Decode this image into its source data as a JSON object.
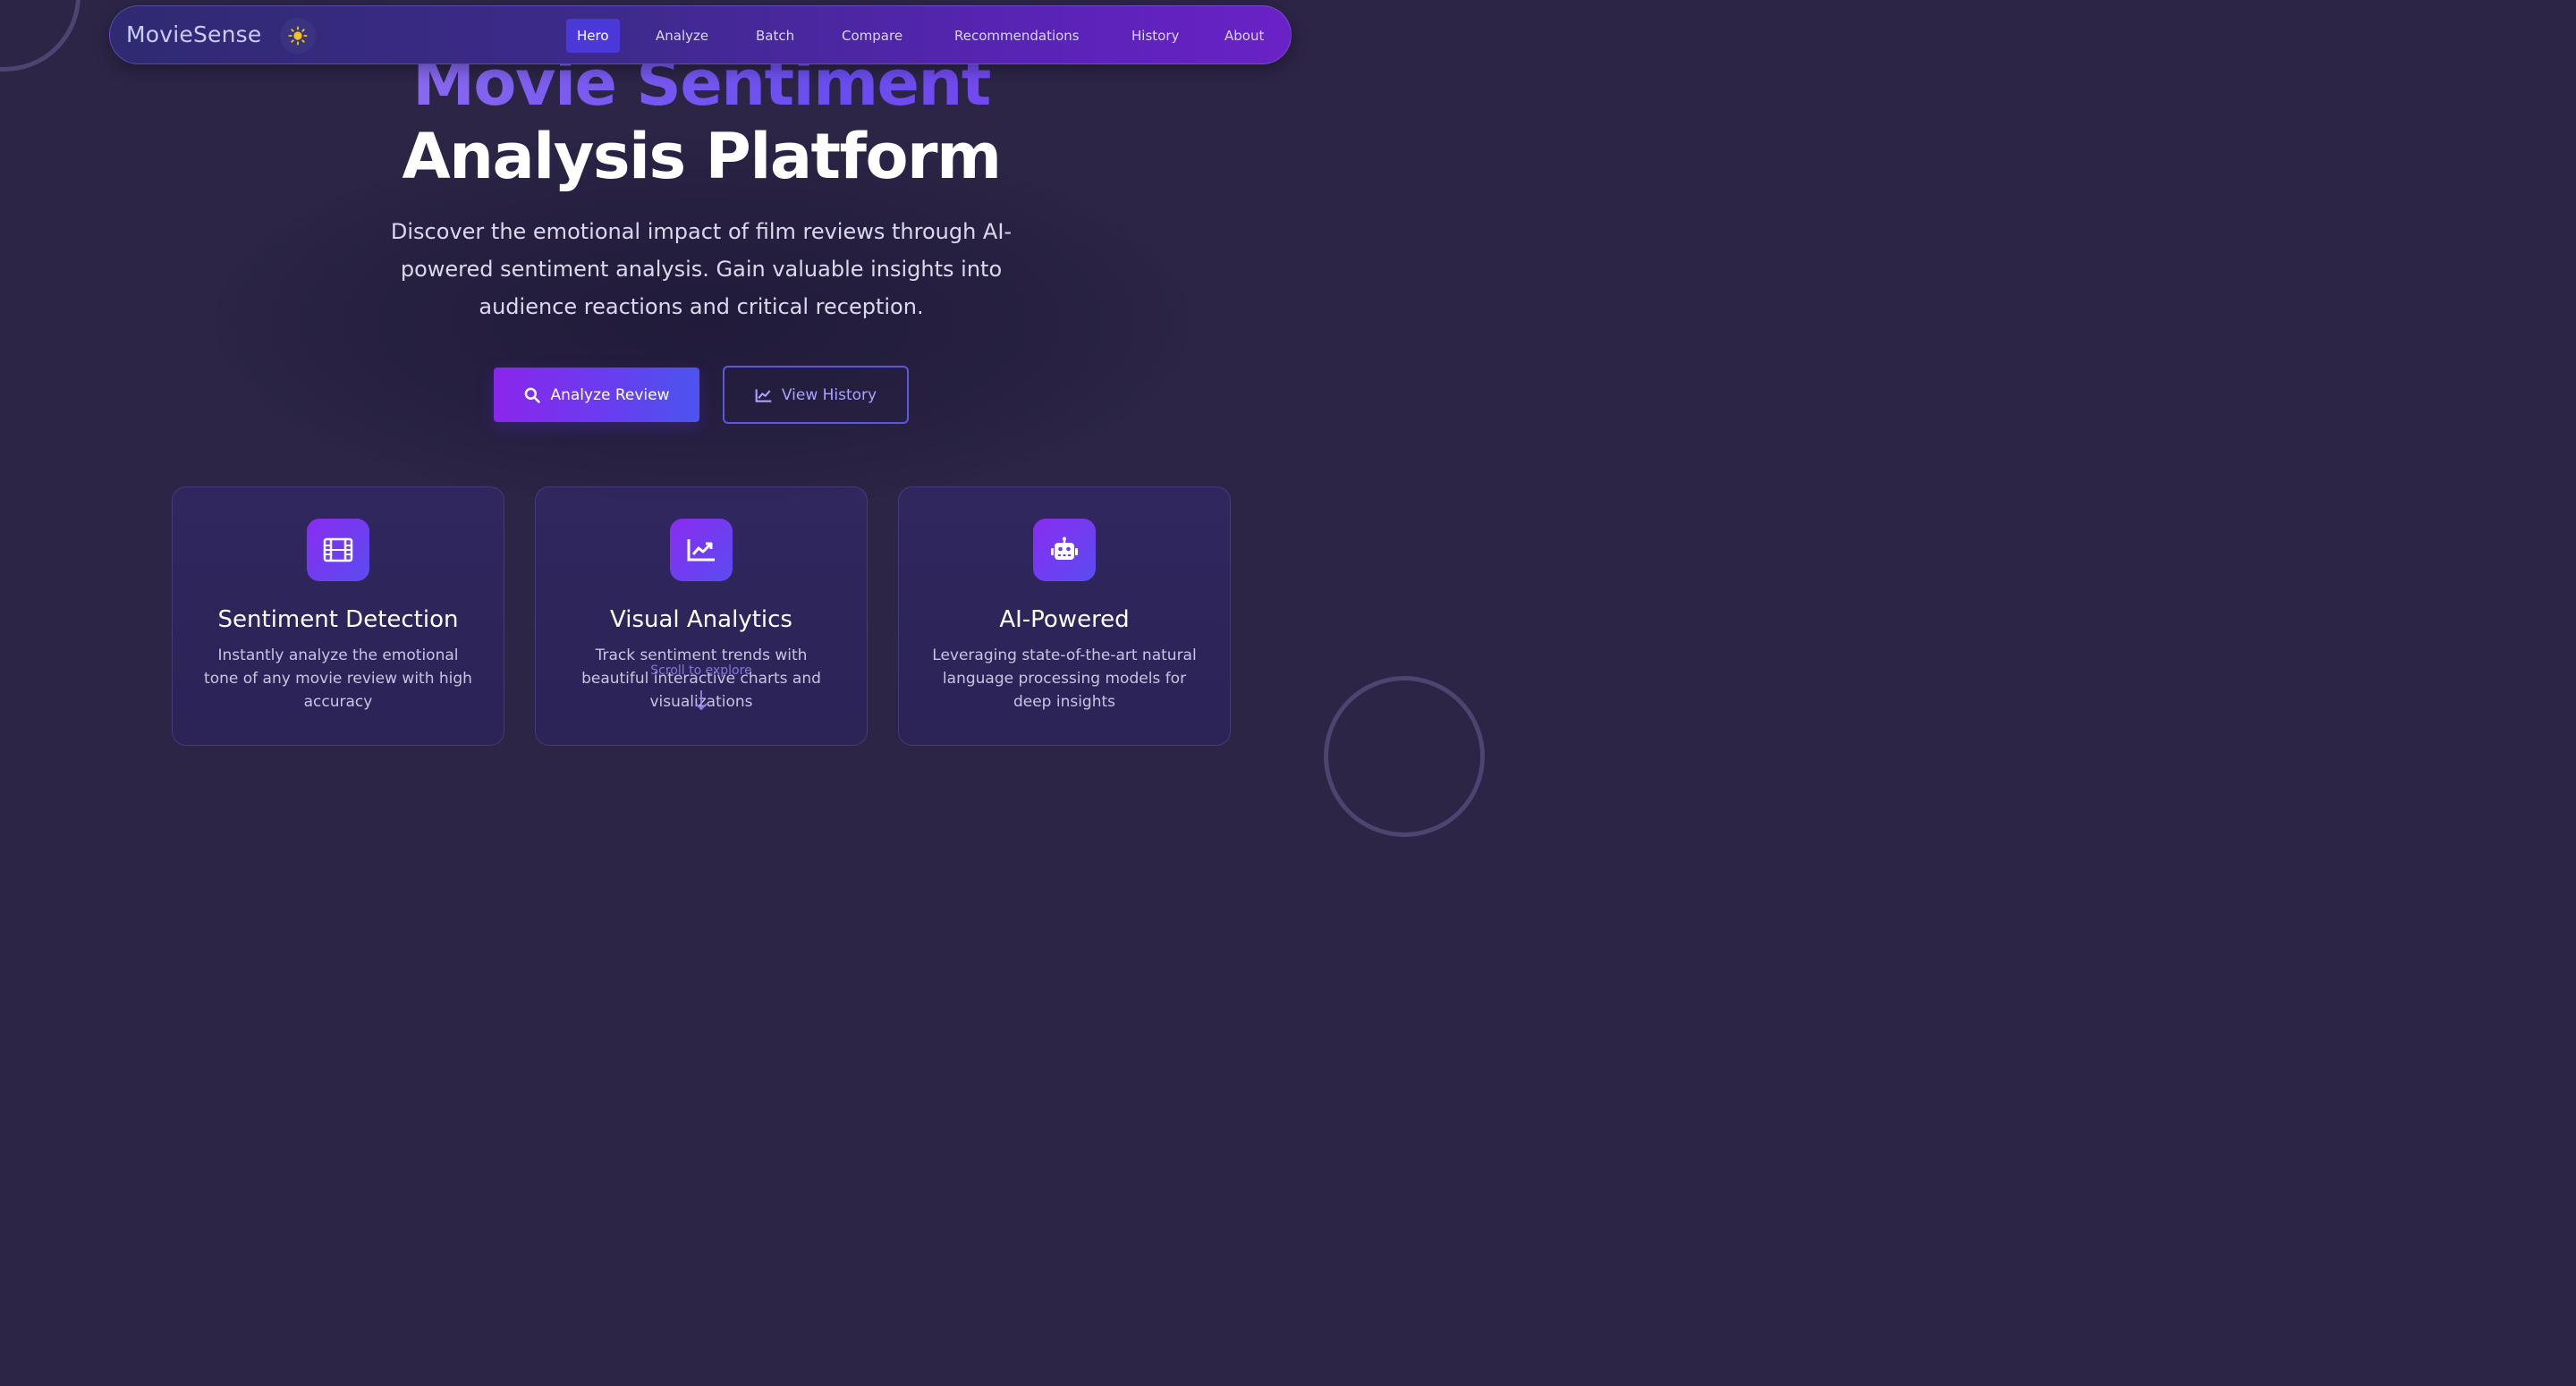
{
  "nav": {
    "brand": "MovieSense",
    "theme_toggle_icon": "sun-icon",
    "links": [
      "Hero",
      "Analyze",
      "Batch",
      "Compare",
      "Recommendations",
      "History",
      "About"
    ],
    "active": "Hero"
  },
  "hero": {
    "title_line1": "Movie Sentiment",
    "title_line2": "Analysis Platform",
    "subtitle": "Discover the emotional impact of film reviews through AI-powered sentiment analysis. Gain valuable insights into audience reactions and critical reception.",
    "primary_button": "Analyze Review",
    "primary_button_icon": "search-icon",
    "secondary_button": "View History",
    "secondary_button_icon": "line-chart-icon"
  },
  "features": [
    {
      "icon": "film-icon",
      "title": "Sentiment Detection",
      "description": "Instantly analyze the emotional tone of any movie review with high accuracy"
    },
    {
      "icon": "chart-icon",
      "title": "Visual Analytics",
      "description": "Track sentiment trends with beautiful interactive charts and visualizations"
    },
    {
      "icon": "robot-icon",
      "title": "AI-Powered",
      "description": "Leveraging state-of-the-art natural language processing models for deep insights"
    }
  ],
  "scroll_hint": "Scroll to explore",
  "colors": {
    "background": "#2c2546",
    "accent_purple": "#8a26ec",
    "accent_indigo": "#4a55ee",
    "nav_active": "#4a39d8",
    "sun": "#f5c518"
  }
}
